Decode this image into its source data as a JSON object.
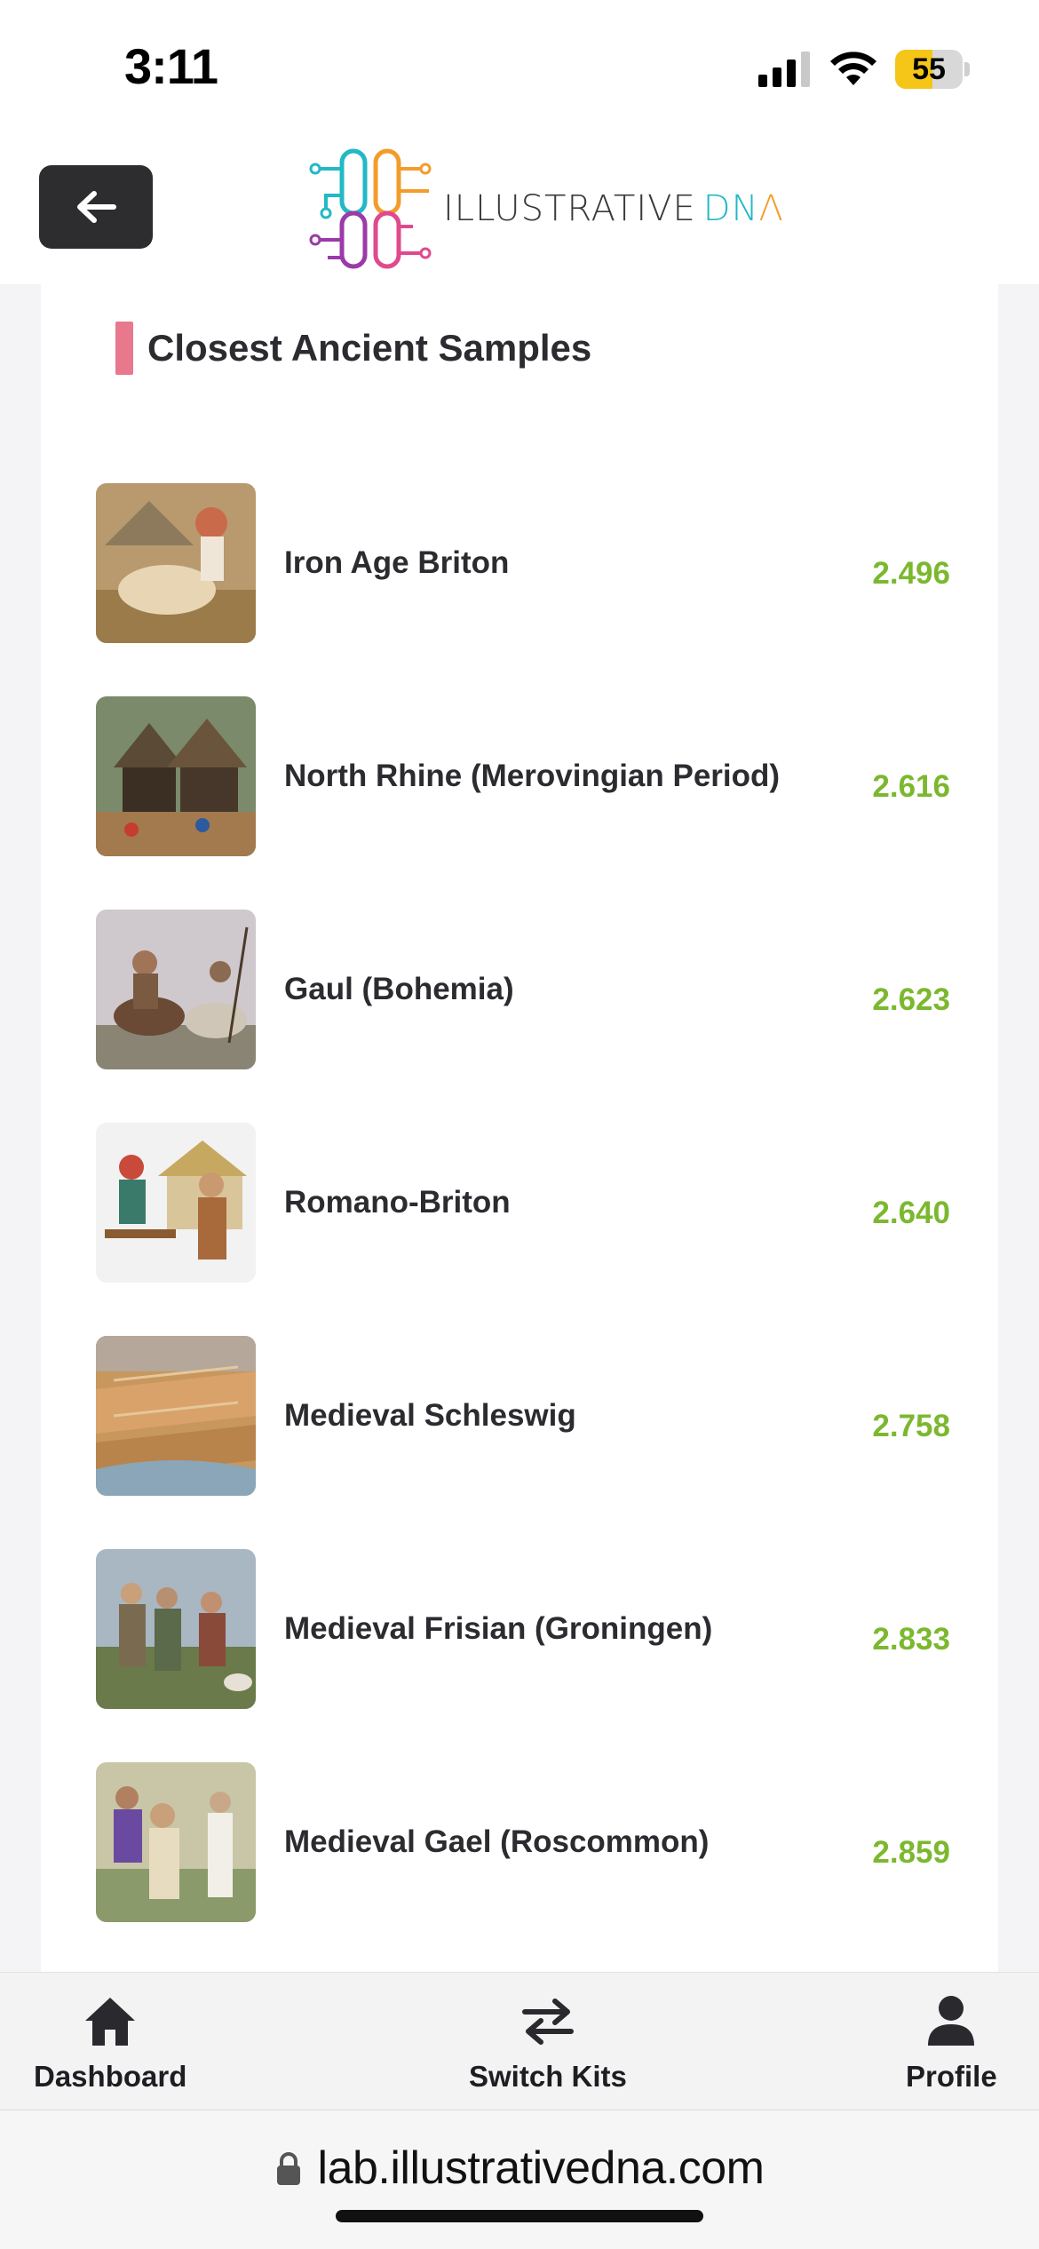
{
  "status_bar": {
    "time": "3:11",
    "battery_level": "55",
    "battery_fraction": 0.55
  },
  "header": {
    "back_icon": "arrow-left-icon",
    "logo_text_main": "ILLUSTRATIVE",
    "logo_text_dna": "DN",
    "logo_text_dna_last": "Λ"
  },
  "section": {
    "title": "Closest Ancient Samples",
    "samples": [
      {
        "name": "Iron Age Briton",
        "score": "2.496"
      },
      {
        "name": "North Rhine (Merovingian Period)",
        "score": "2.616"
      },
      {
        "name": "Gaul (Bohemia)",
        "score": "2.623"
      },
      {
        "name": "Romano-Briton",
        "score": "2.640"
      },
      {
        "name": "Medieval Schleswig",
        "score": "2.758"
      },
      {
        "name": "Medieval Frisian (Groningen)",
        "score": "2.833"
      },
      {
        "name": "Medieval Gael (Roscommon)",
        "score": "2.859"
      }
    ]
  },
  "bottom_nav": {
    "dashboard": {
      "label": "Dashboard",
      "icon": "home-icon"
    },
    "switch_kits": {
      "label": "Switch Kits",
      "icon": "swap-arrows-icon"
    },
    "profile": {
      "label": "Profile",
      "icon": "person-icon"
    }
  },
  "browser": {
    "url": "lab.illustrativedna.com",
    "icon": "lock-icon"
  },
  "colors": {
    "accent": "#e8788c",
    "score": "#7cb82f",
    "back_button": "#2d2d2f"
  }
}
